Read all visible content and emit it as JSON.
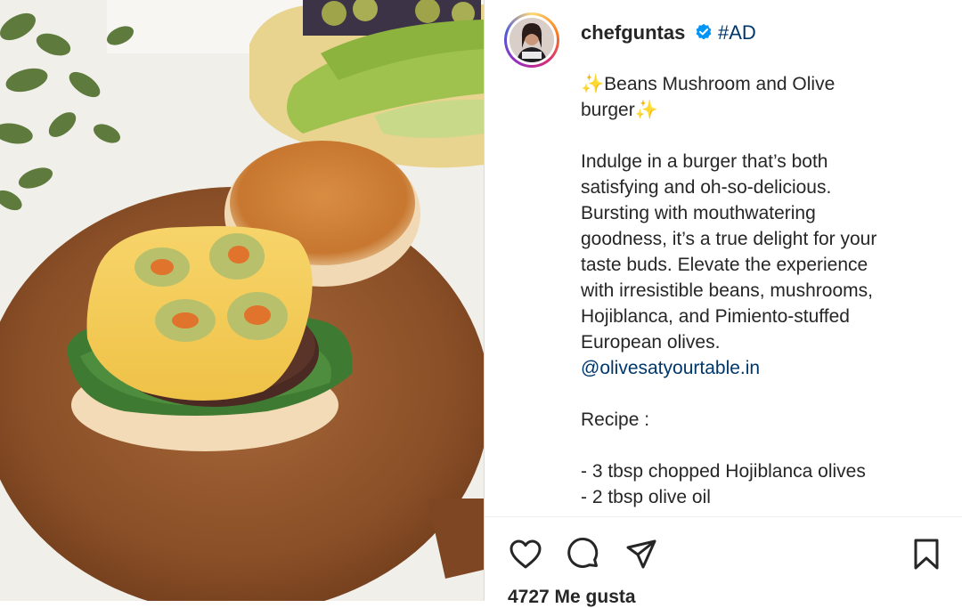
{
  "post": {
    "username": "chefguntas",
    "ad_tag": "#AD",
    "caption": {
      "title_line1": "✨Beans Mushroom and Olive",
      "title_line2": "burger✨",
      "body_lines": [
        "Indulge in a burger that’s both",
        "satisfying and oh-so-delicious.",
        "Bursting with mouthwatering",
        "goodness, it’s a true delight for your",
        "taste buds. Elevate the experience",
        "with irresistible beans, mushrooms,",
        "Hojiblanca, and Pimiento-stuffed",
        "European olives."
      ],
      "mention": "@olivesatyourtable.in",
      "recipe_label": "Recipe :",
      "ingredients": [
        "- 3 tbsp chopped Hojiblanca olives",
        "- 2 tbsp olive oil"
      ]
    },
    "likes_text": "4727 Me gusta"
  },
  "icons": {
    "like": "heart-icon",
    "comment": "comment-icon",
    "share": "share-icon",
    "save": "bookmark-icon",
    "verified": "verified-badge-icon"
  },
  "colors": {
    "text": "#262626",
    "link": "#00376b",
    "verified": "#0095f6"
  }
}
